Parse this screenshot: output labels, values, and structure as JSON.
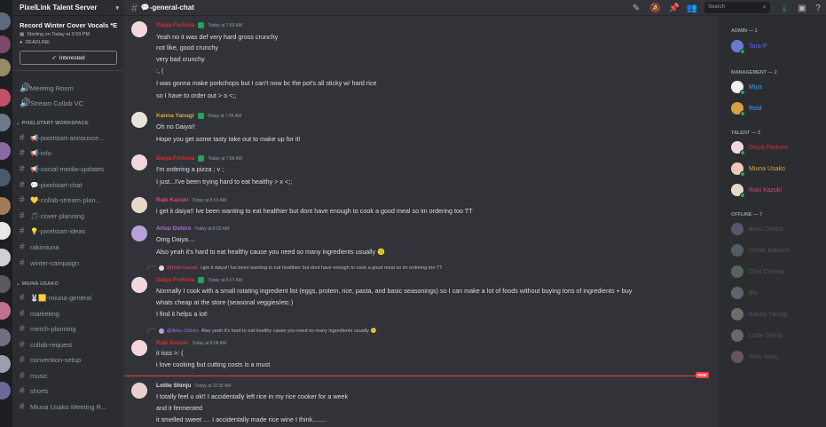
{
  "server": {
    "name": "PixelLink Talent Server",
    "event": {
      "title": "Record Winter Cover Vocals *EX",
      "start": "Starting on Today at 3:59 PM",
      "tag": "DEADLINE",
      "interested_label": "Interested"
    }
  },
  "sidebar": {
    "voice": [
      {
        "label": "Meeting Room"
      },
      {
        "label": "Stream Collab VC"
      }
    ],
    "categories": [
      {
        "label": "PIXELSTART WORKSPACE"
      },
      {
        "label": "MIUNA USAKO"
      }
    ],
    "channels": [
      {
        "label": "📢-pixelstart-announce..."
      },
      {
        "label": "📢-info"
      },
      {
        "label": "📢-social-media-updates"
      },
      {
        "label": "💬-pixelstart-chat"
      },
      {
        "label": "💛-collab-stream-plan..."
      },
      {
        "label": "🎵-cover-planning"
      },
      {
        "label": "💡-pixelstart-ideas"
      },
      {
        "label": "rakimiuna"
      },
      {
        "label": "winter-campaign"
      },
      {
        "label": "🐰🟨-miuna-general"
      },
      {
        "label": "marketing"
      },
      {
        "label": "merch-planning"
      },
      {
        "label": "collab-request"
      },
      {
        "label": "convention-setup"
      },
      {
        "label": "music"
      },
      {
        "label": "shorts"
      },
      {
        "label": "Miuna Usako Meeting R..."
      }
    ]
  },
  "header": {
    "channel": "💬-general-chat",
    "search_placeholder": "Search"
  },
  "messages": [
    {
      "user": "Daiya Fortuna",
      "color": "#d9302c",
      "time": "Today at 7:50 AM",
      "lines": [
        "Yeah no it was def very hard gross crunchy",
        "not like, good crunchy",
        "very bad crunchy",
        ":, (",
        "I was gonna make porkchops but I can't now bc the pot's all sticky w/ hard rice",
        "so I have to order out > o <;;"
      ]
    },
    {
      "user": "Kanna Yanagi",
      "color": "#e6a23c",
      "time": "Today at 7:56 AM",
      "lines": [
        "Oh no Daiya!!",
        "Hope you get some tasty take out to make up for it!"
      ]
    },
    {
      "user": "Daiya Fortuna",
      "color": "#d9302c",
      "time": "Today at 7:58 AM",
      "lines": [
        "I'm ordering a pizza ; v ;",
        "I just...I've been trying hard to eat healthy > x <;;"
      ]
    },
    {
      "user": "Raki Kazuki",
      "color": "#e0457b",
      "time": "Today at 8:01 AM",
      "lines": [
        "i get it daiya!! Ive been wanting to eat healthier but dont have enough to cook a good meal so im ordering too TT"
      ]
    },
    {
      "user": "Arisu Oshiro",
      "color": "#b86be0",
      "time": "Today at 8:02 AM",
      "lines": [
        "Omg Daiya....",
        "Also yeah it's hard to eat healthy cause you need so many ingredients usually 😕"
      ]
    },
    {
      "user": "Daiya Fortuna",
      "color": "#d9302c",
      "time": "Today at 8:07 AM",
      "reply": {
        "user": "@Raki Kazuki",
        "text": "i get it daiya!! Ive been wanting to eat healthier but dont have enough to cook a good meal so im ordering too TT"
      },
      "lines": [
        "Normally I cook with a small rotating ingredient list (eggs, protein, rice, pasta, and basic seasonings) so I can make a lot of foods without buying tons of ingredients + buy",
        "whats cheap at the store (seasonal veggies/etc.)",
        "I find it helps a lot!"
      ]
    },
    {
      "user": "Raki Kazuki",
      "color": "#e0457b",
      "time": "Today at 8:08 AM",
      "reply": {
        "user": "@Arisu Oshiro",
        "text": "Also yeah it's hard to eat healthy cause you need so many ingredients usually 😕"
      },
      "lines": [
        "it isss >: (",
        "i love cooking but cutting costs is a must"
      ]
    },
    {
      "user": "Lottie Shinju",
      "color": "#dbdee1",
      "time": "Today at 11:35 AM",
      "lines": [
        "I totally feel u ok!! I accidentally left rice in my rice cooker for a week",
        "and it fermented",
        "it smelled sweet .... I accidentally made rice wine I think........"
      ]
    }
  ],
  "new_label": "NEW",
  "members": {
    "categories": [
      "ADMIN — 1",
      "MANAGEMENT — 2",
      "TALENT — 3",
      "OFFLINE — 7"
    ],
    "admin": [
      {
        "name": "Tora-P",
        "color": "#5865f2"
      }
    ],
    "management": [
      {
        "name": "Miya",
        "color": "#3ba0ff"
      },
      {
        "name": "Reid",
        "color": "#3ba0ff"
      }
    ],
    "talent": [
      {
        "name": "Daiya Fortuna",
        "color": "#d9302c"
      },
      {
        "name": "Miuna Usako",
        "color": "#e6a23c"
      },
      {
        "name": "Raki Kazuki",
        "color": "#e0457b"
      }
    ],
    "offline": [
      {
        "name": "Arisu Oshiro"
      },
      {
        "name": "Chiaki Katsumi"
      },
      {
        "name": "Chiu Chompi"
      },
      {
        "name": "Blu"
      },
      {
        "name": "Kanna Yanagi"
      },
      {
        "name": "Lottie Shinju"
      },
      {
        "name": "Rein Noou"
      }
    ]
  }
}
